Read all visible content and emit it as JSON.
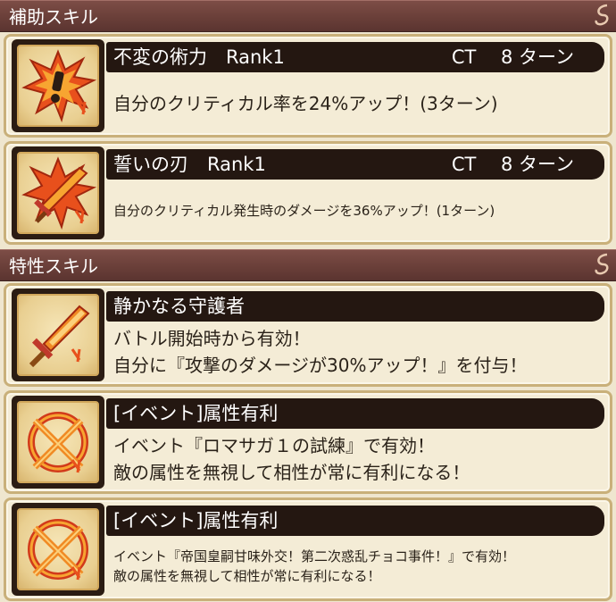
{
  "sections": {
    "support": {
      "title": "補助スキル"
    },
    "trait": {
      "title": "特性スキル"
    }
  },
  "support_skills": [
    {
      "name": "不変の術力　Rank1",
      "ct": "CT　 8 ターン",
      "desc": "自分のクリティカル率を24%アップ！(3ターン)",
      "icon": "exclamation-burst-icon"
    },
    {
      "name": "誓いの刃　Rank1",
      "ct": "CT　 8 ターン",
      "desc": "自分のクリティカル発生時のダメージを36%アップ！(1ターン)",
      "icon": "flaming-sword-icon"
    }
  ],
  "trait_skills": [
    {
      "name": "静かなる守護者",
      "desc_line1": "バトル開始時から有効！",
      "desc_line2": "自分に『攻撃のダメージが30%アップ！』を付与！",
      "icon": "sword-icon"
    },
    {
      "name": "[イベント]属性有利",
      "desc_line1": "イベント『ロマサガ１の試練』で有効！",
      "desc_line2": "敵の属性を無視して相性が常に有利になる！",
      "icon": "crossed-sword-circle-icon"
    },
    {
      "name": "[イベント]属性有利",
      "desc_line1": "イベント『帝国皇嗣甘味外交！第二次惑乱チョコ事件！』で有効！",
      "desc_line2": "敵の属性を無視して相性が常に有利になる！",
      "icon": "crossed-sword-circle-icon"
    }
  ],
  "colors": {
    "header_bg": "#6a3f39",
    "title_bar_bg": "#241711",
    "card_bg": "#f4ecd6",
    "card_border": "#c9b07a"
  }
}
